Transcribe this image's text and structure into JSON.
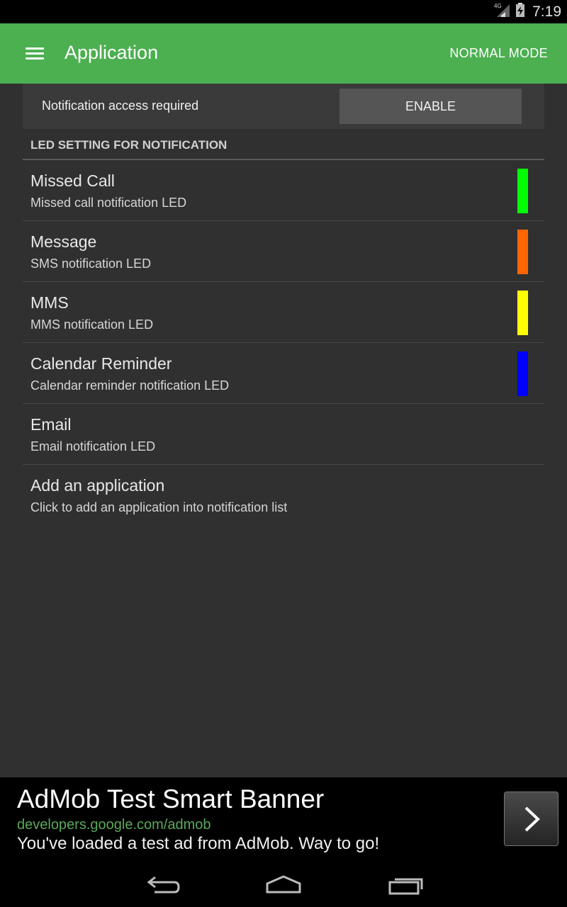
{
  "status_bar": {
    "network": "4G",
    "time": "7:19"
  },
  "app_bar": {
    "menu_icon": "hamburger-menu-icon",
    "title": "Application",
    "mode_action": "NORMAL MODE",
    "background": "#4caf50"
  },
  "notice": {
    "text": "Notification access required",
    "button_label": "ENABLE"
  },
  "section_header": "LED SETTING FOR NOTIFICATION",
  "items": [
    {
      "title": "Missed Call",
      "subtitle": "Missed call notification LED",
      "led_color": "#00ff00"
    },
    {
      "title": "Message",
      "subtitle": "SMS notification LED",
      "led_color": "#ff6600"
    },
    {
      "title": "MMS",
      "subtitle": "MMS notification LED",
      "led_color": "#ffff00"
    },
    {
      "title": "Calendar Reminder",
      "subtitle": "Calendar reminder notification LED",
      "led_color": "#0000ff"
    },
    {
      "title": "Email",
      "subtitle": "Email notification LED",
      "led_color": ""
    },
    {
      "title": "Add an application",
      "subtitle": "Click to add an application into notification list",
      "led_color": ""
    }
  ],
  "ad": {
    "title": "AdMob Test Smart Banner",
    "url": "developers.google.com/admob",
    "text": "You've loaded a test ad from AdMob. Way to go!",
    "arrow_icon": "chevron-right-icon"
  },
  "nav_bar": {
    "back_icon": "back-icon",
    "home_icon": "home-icon",
    "recents_icon": "recent-apps-icon"
  }
}
